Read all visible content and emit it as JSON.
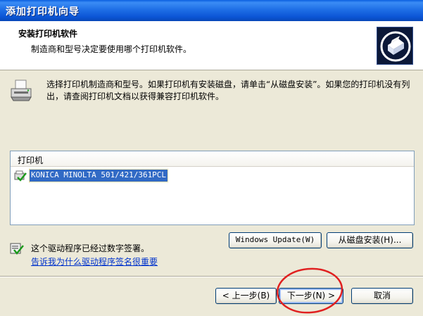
{
  "window": {
    "title": "添加打印机向导"
  },
  "header": {
    "title": "安装打印机软件",
    "subtitle": "制造商和型号决定要使用哪个打印机软件。",
    "icon": "printer-setup-icon"
  },
  "intro": {
    "icon": "printer-icon",
    "text": "选择打印机制造商和型号。如果打印机有安装磁盘，请单击“从磁盘安装”。如果您的打印机没有列出，请查阅打印机文档以获得兼容打印机软件。"
  },
  "printer_list": {
    "header": "打印机",
    "items": [
      {
        "label": "KONICA MINOLTA 501/421/361PCL",
        "selected": true,
        "icon": "signed-driver-icon"
      }
    ]
  },
  "buttons": {
    "windows_update": "Windows Update(W)",
    "have_disk": "从磁盘安装(H)...",
    "back": "< 上一步(B)",
    "next": "下一步(N) >",
    "cancel": "取消"
  },
  "signature": {
    "icon": "signed-driver-icon",
    "text": "这个驱动程序已经过数字签署。",
    "link": "告诉我为什么驱动程序签名很重要"
  },
  "colors": {
    "titlebar": "#0b55d6",
    "selection": "#316ac5",
    "annotation_circle": "#e02020",
    "link": "#0033cc"
  }
}
